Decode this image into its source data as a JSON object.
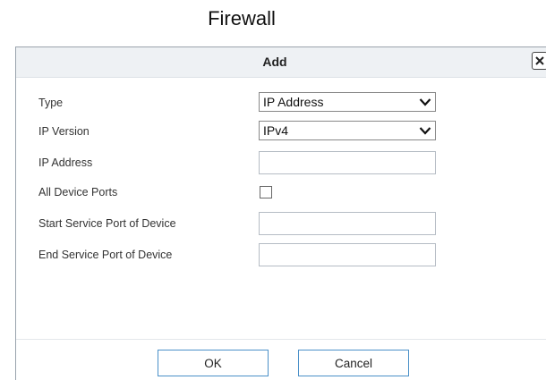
{
  "page": {
    "title": "Firewall"
  },
  "dialog": {
    "title": "Add",
    "close_icon": "close-icon",
    "fields": {
      "type": {
        "label": "Type",
        "value": "IP Address"
      },
      "ip_version": {
        "label": "IP Version",
        "value": "IPv4"
      },
      "ip_address": {
        "label": "IP Address",
        "value": ""
      },
      "all_device_ports": {
        "label": "All Device Ports",
        "checked": false
      },
      "start_service_port": {
        "label": "Start Service Port of Device",
        "value": ""
      },
      "end_service_port": {
        "label": "End Service Port of Device",
        "value": ""
      }
    },
    "buttons": {
      "ok_label": "OK",
      "cancel_label": "Cancel"
    }
  },
  "colors": {
    "header_bg": "#eef1f4",
    "button_border": "#4a90c8",
    "dialog_border": "#9aa3ad"
  }
}
